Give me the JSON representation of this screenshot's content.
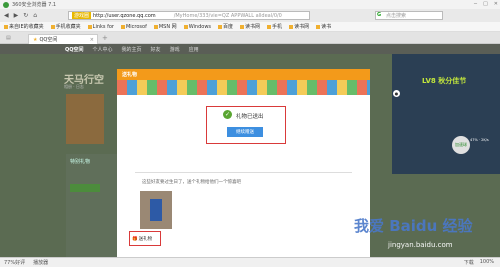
{
  "browser": {
    "title": "360安全浏览器 7.1",
    "tab_label": "QQ空间",
    "url_badge": "游戏圈",
    "url_host": "http://user.qzone.qq.com",
    "url_path": "/MyHome/333/vie=QZ APPWALL alldeal/0/0",
    "search_placeholder": "点击搜索",
    "favorites": [
      "来自IE的收藏夹",
      "手机收藏夹",
      "Links for",
      "Microsof",
      "MSN 网",
      "Windows",
      "百度",
      "读书网",
      "手机",
      "读书网",
      "读书"
    ]
  },
  "qzone": {
    "nav_brand": "QQ空间",
    "nav_items": [
      "个人中心",
      "我的主页",
      "好友",
      "游戏",
      "应用"
    ],
    "page_title": "天马行空",
    "page_subtitle": "相册 · 日志",
    "left_panel_text": "特别礼物",
    "right_ad_text": "LV8 秋分佳节",
    "bubble_text": "加速球",
    "bubble_values": "47% · 2K/s"
  },
  "dialog": {
    "header": "送礼物",
    "success_text": "礼物已送出",
    "blue_button": "继续赠送",
    "lost_text": "这些好友要过生日了，送个礼物给他们一个惊喜吧",
    "gift_button": "送礼物"
  },
  "statusbar": {
    "left_items": [
      "77%好评",
      "播放器"
    ],
    "right_items": [
      "下载",
      "100%"
    ]
  },
  "watermark": {
    "main": "我爱 Baidu 经验",
    "sub": "jingyan.baidu.com"
  }
}
